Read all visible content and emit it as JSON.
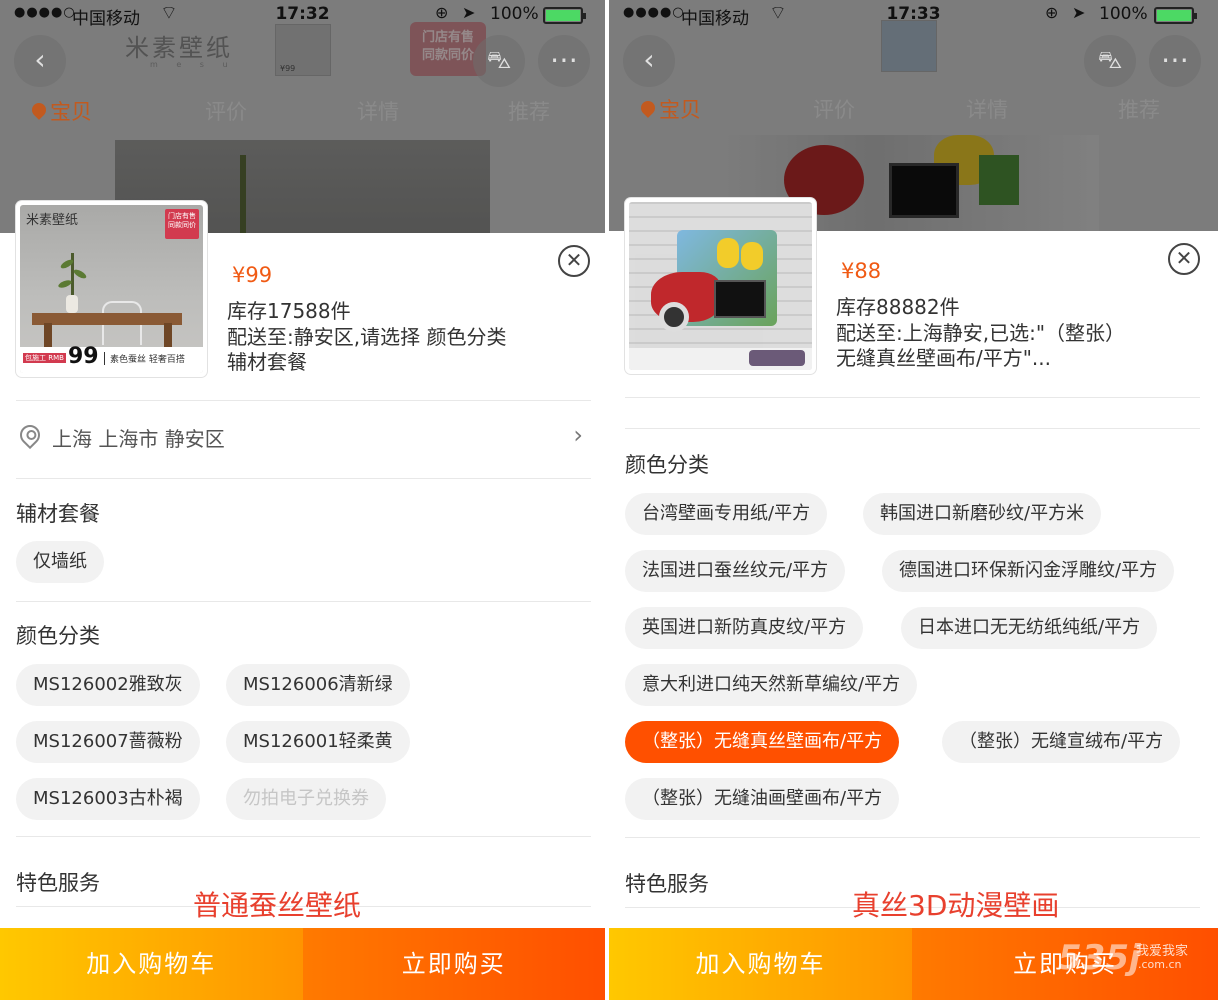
{
  "left": {
    "status": {
      "signal": "●●●●○",
      "carrier": "中国移动",
      "wifi": "⌔",
      "time": "17:32",
      "battery": "100%"
    },
    "nav": {
      "back": "‹",
      "cart": "⛍",
      "more": "⋯",
      "tabs": [
        "宝贝",
        "评价",
        "详情",
        "推荐"
      ]
    },
    "background": {
      "brand": "米素壁纸",
      "brand_sub": "m e s u",
      "thumb_price": "¥99",
      "stamp": "门店有售\n同款同价"
    },
    "product_image": {
      "logo": "米素壁纸",
      "badge": "门店有售 同款同价",
      "price_prefix": "包施工 RMB",
      "price": "99",
      "slogan": "素色蚕丝 轻奢百搭"
    },
    "price": "¥99",
    "stock": "库存17588件",
    "delivery": "配送至:静安区,请选择 颜色分类 辅材套餐",
    "close": "✕",
    "address": "上海 上海市 静安区",
    "address_arrow": "›",
    "section_materials": "辅材套餐",
    "materials": [
      "仅墙纸"
    ],
    "section_colors": "颜色分类",
    "colors": [
      "MS126002雅致灰",
      "MS126006清新绿",
      "MS126007蔷薇粉",
      "MS126001轻柔黄",
      "MS126003古朴褐",
      "勿拍电子兑换券"
    ],
    "section_services": "特色服务",
    "caption": "普通蚕丝壁纸",
    "add_to_cart": "加入购物车",
    "buy_now": "立即购买"
  },
  "right": {
    "status": {
      "signal": "●●●●○",
      "carrier": "中国移动",
      "wifi": "⌔",
      "time": "17:33",
      "battery": "100%"
    },
    "nav": {
      "back": "‹",
      "cart": "⛍",
      "more": "⋯",
      "tabs": [
        "宝贝",
        "评价",
        "详情",
        "推荐"
      ]
    },
    "price": "¥88",
    "stock": "库存88882件",
    "delivery": "配送至:上海静安,已选:\"（整张）无缝真丝壁画布/平方\"...",
    "close": "✕",
    "section_colors": "颜色分类",
    "colors": [
      "台湾壁画专用纸/平方",
      "韩国进口新磨砂纹/平方米",
      "法国进口蚕丝纹元/平方",
      "德国进口环保新闪金浮雕纹/平方",
      "英国进口新防真皮纹/平方",
      "日本进口无无纺纸纯纸/平方",
      "意大利进口纯天然新草编纹/平方",
      "（整张）无缝真丝壁画布/平方",
      "（整张）无缝宣绒布/平方",
      "（整张）无缝油画壁画布/平方"
    ],
    "selected_color": "（整张）无缝真丝壁画布/平方",
    "section_services": "特色服务",
    "caption": "真丝3D动漫壁画",
    "add_to_cart": "加入购物车",
    "buy_now": "立即购买"
  },
  "site_logo": {
    "mark": "535j",
    "line1": "我爱我家",
    "line2": ".com.cn"
  },
  "colors": {
    "accent": "#ff5000",
    "price": "#f05a14",
    "cart_gradient": [
      "#ffc800",
      "#ff9400"
    ],
    "buy_gradient": [
      "#ff7a00",
      "#ff4f00"
    ],
    "tab_active": "#c25a1f",
    "caption": "#e8402e"
  }
}
